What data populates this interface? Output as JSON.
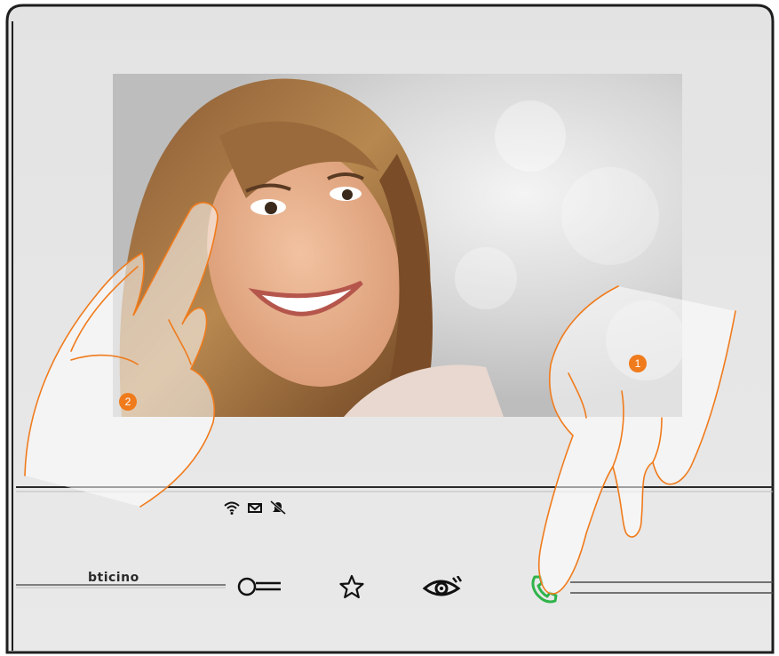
{
  "device": {
    "brand": "bticino",
    "screen": {
      "content": "video-feed",
      "subject": "smiling-woman"
    },
    "status_icons": [
      "wifi-icon",
      "mail-icon",
      "muted-bell-icon"
    ],
    "buttons": [
      {
        "name": "door-lock-button",
        "icon": "key-icon"
      },
      {
        "name": "favourite-button",
        "icon": "star-icon"
      },
      {
        "name": "camera-cycle-button",
        "icon": "eye-icon"
      },
      {
        "name": "answer-button",
        "icon": "phone-icon",
        "color": "#2fb34a"
      }
    ]
  },
  "callouts": {
    "step1": "1",
    "step2": "2"
  },
  "colors": {
    "callout": "#f07b1c",
    "answer": "#2fb34a",
    "body": "#e5e5e5"
  }
}
